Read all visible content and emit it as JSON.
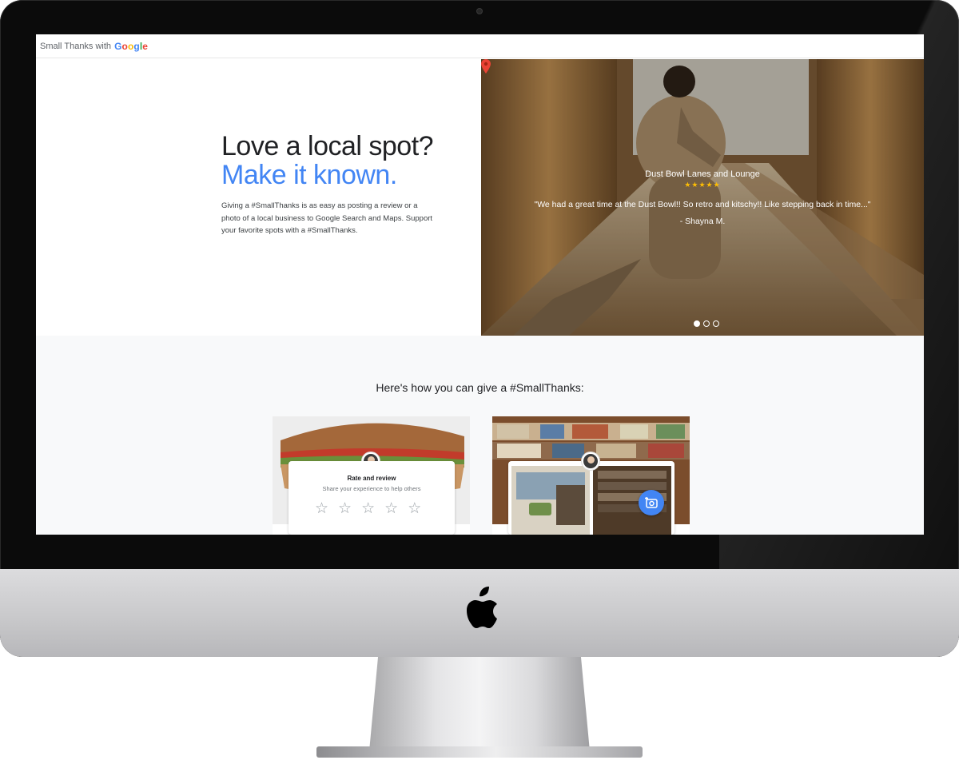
{
  "header": {
    "brand_text": "Small Thanks with",
    "google_letters": [
      "G",
      "o",
      "o",
      "g",
      "l",
      "e"
    ]
  },
  "hero": {
    "headline_line1": "Love a local spot?",
    "headline_line2": "Make it known.",
    "intro": "Giving a #SmallThanks is as easy as posting a review or a photo of a local business to Google Search and Maps. Support your favorite spots with a #SmallThanks."
  },
  "carousel": {
    "place_name": "Dust Bowl Lanes and Lounge",
    "rating_stars": "★★★★★",
    "rating_value": 5,
    "quote": "\"We had a great time at the Dust Bowl!! So retro and kitschy!! Like stepping back in time...\"",
    "author": "- Shayna M.",
    "slide_count": 3,
    "active_slide": 1
  },
  "how": {
    "title": "Here's how you can give a #SmallThanks:",
    "card1": {
      "title": "Rate and review",
      "subtitle": "Share your experience to help others",
      "stars": [
        "☆",
        "☆",
        "☆",
        "☆",
        "☆"
      ]
    }
  },
  "colors": {
    "google_blue": "#4285f4",
    "google_red": "#ea4335",
    "google_yellow": "#fbbc05",
    "google_green": "#34a853",
    "section_bg": "#f8f9fa"
  },
  "icons": {
    "map_pin": "map-pin-icon",
    "add_photo": "add-photo-icon",
    "apple": "apple-logo-icon",
    "star": "star-icon"
  }
}
